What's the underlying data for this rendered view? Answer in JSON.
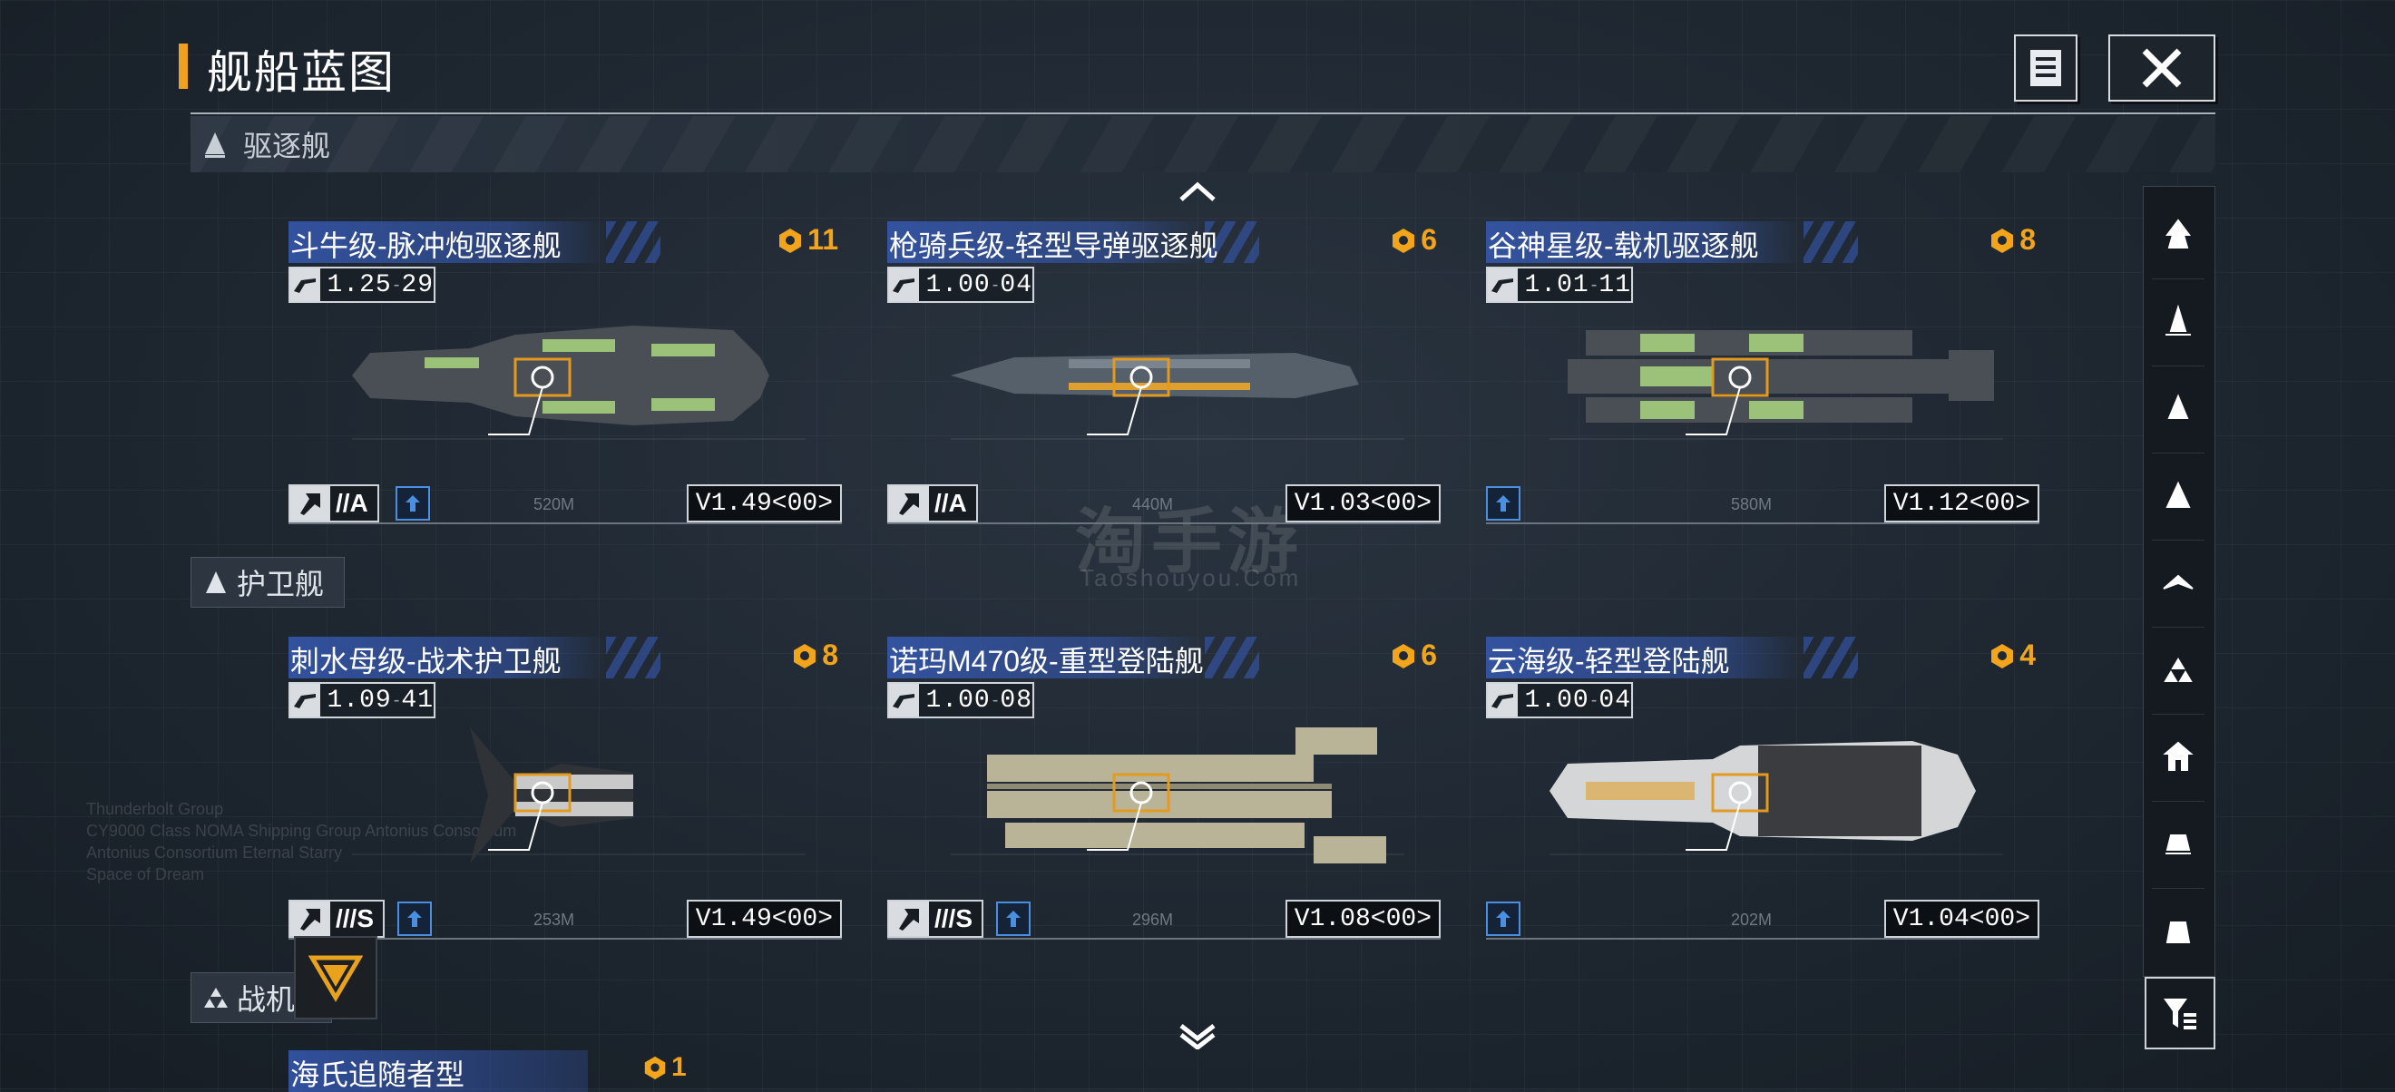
{
  "header": {
    "title": "舰船蓝图",
    "notes_icon": "document-icon",
    "close_icon": "close-icon"
  },
  "category_bar": {
    "label": "驱逐舰"
  },
  "sections": [
    {
      "label": "护卫舰"
    },
    {
      "label": "战机"
    }
  ],
  "watermark": {
    "main": "淘手游",
    "sub": "Taoshouyou.Com"
  },
  "cards": [
    {
      "name": "斗牛级-脉冲炮驱逐舰",
      "cost": "11",
      "stat": "1.25",
      "stat_sub": "29",
      "tier": "//A",
      "version": "V1.49<00>",
      "length": "520M",
      "hull": "green"
    },
    {
      "name": "枪骑兵级-轻型导弹驱逐舰",
      "cost": "6",
      "stat": "1.00",
      "stat_sub": "04",
      "tier": "//A",
      "version": "V1.03<00>",
      "length": "440M",
      "hull": "gray"
    },
    {
      "name": "谷神星级-载机驱逐舰",
      "cost": "8",
      "stat": "1.01",
      "stat_sub": "11",
      "tier": "",
      "version": "V1.12<00>",
      "length": "580M",
      "hull": "green"
    },
    {
      "name": "刺水母级-战术护卫舰",
      "cost": "8",
      "stat": "1.09",
      "stat_sub": "41",
      "tier": "///S",
      "version": "V1.49<00>",
      "length": "253M",
      "hull": "dark"
    },
    {
      "name": "诺玛M470级-重型登陆舰",
      "cost": "6",
      "stat": "1.00",
      "stat_sub": "08",
      "tier": "///S",
      "version": "V1.08<00>",
      "length": "296M",
      "hull": "tan"
    },
    {
      "name": "云海级-轻型登陆舰",
      "cost": "4",
      "stat": "1.00",
      "stat_sub": "04",
      "tier": "",
      "version": "V1.04<00>",
      "length": "202M",
      "hull": "white"
    }
  ],
  "partial_card": {
    "name": "海氏追随者型",
    "cost": "1"
  },
  "colors": {
    "accent": "#f0a021",
    "title_bar": "#3659b2",
    "cost": "#f2a51a",
    "badge": "#4a8fe0"
  },
  "rail_icons": [
    "flagship-icon",
    "destroyer-icon",
    "frigate-icon",
    "cruiser-icon",
    "carrier-icon",
    "fighter-icon",
    "corvette-icon",
    "battleship-icon",
    "auxiliary-icon"
  ],
  "filter_icon": "filter-icon"
}
